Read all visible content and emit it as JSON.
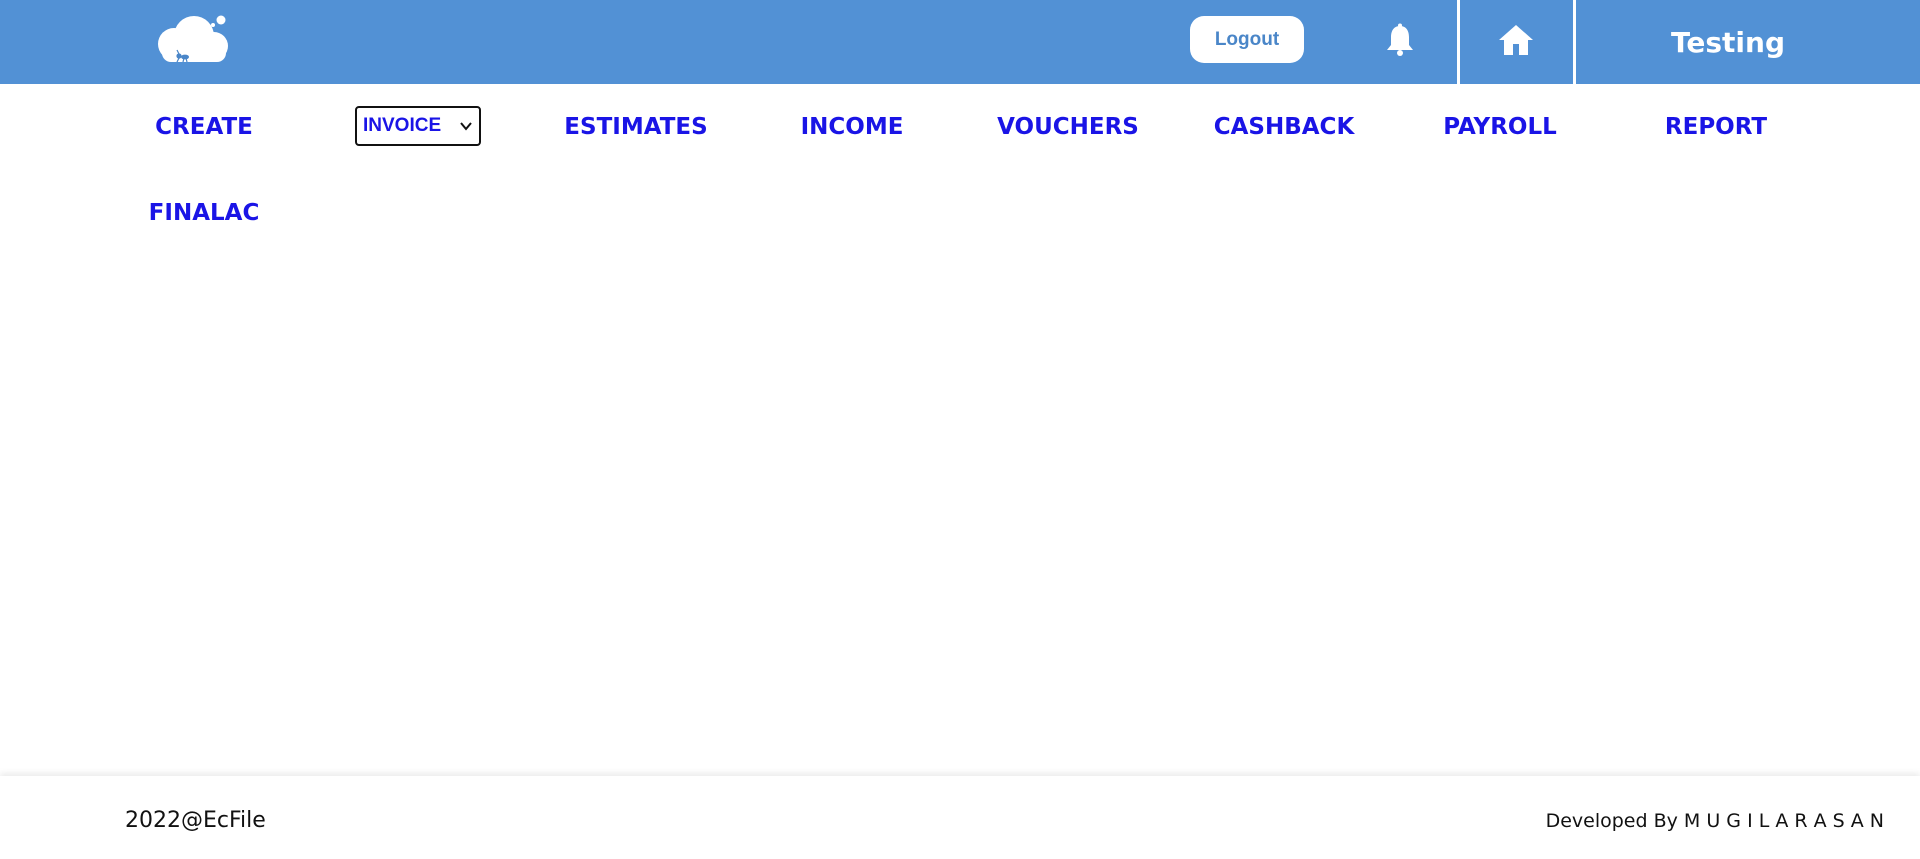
{
  "header": {
    "logout_label": "Logout",
    "user_name": "Testing",
    "icons": [
      "cloud-logo",
      "bell-icon",
      "home-icon"
    ],
    "background_color": "#5291d5"
  },
  "nav": {
    "items": [
      {
        "label": "CREATE"
      },
      {
        "label": "INVOICE",
        "type": "select"
      },
      {
        "label": "ESTIMATES"
      },
      {
        "label": "INCOME"
      },
      {
        "label": "VOUCHERS"
      },
      {
        "label": "CASHBACK"
      },
      {
        "label": "PAYROLL"
      },
      {
        "label": "REPORT"
      },
      {
        "label": "FINALAC"
      }
    ],
    "color": "#1a14e6"
  },
  "footer": {
    "copyright": "2022@EcFile",
    "developed_by_prefix": "Developed By",
    "developer_name": "M U G I L A R A S A N"
  }
}
